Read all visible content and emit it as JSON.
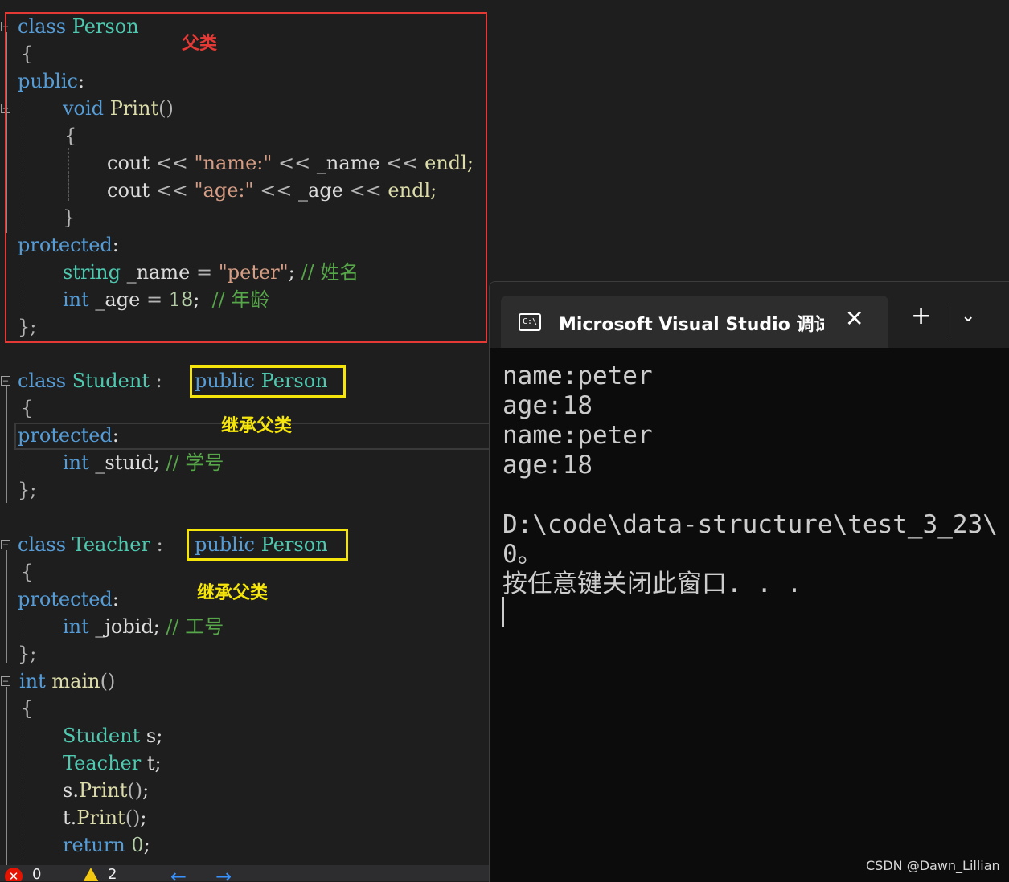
{
  "editor": {
    "annotations": {
      "parent_label": "父类",
      "inherit_label_1": "继承父类",
      "inherit_label_2": "继承父类"
    },
    "code": {
      "l1_kw": "class",
      "l1_ty": "Person",
      "brace_open": "{",
      "brace_close": "}",
      "brace_close_semi": "};",
      "public_kw": "public",
      "colon": ":",
      "void_kw": "void",
      "print_fn": "Print",
      "parens": "()",
      "cout": "cout",
      "shl": "<<",
      "str_name": "\"name:\"",
      "var_name": "_name",
      "endl": "endl;",
      "str_age": "\"age:\"",
      "var_age": "_age",
      "protected_kw": "protected",
      "string_ty": "string",
      "eq": "=",
      "str_peter": "\"peter\"",
      "semi": ";",
      "cm_name": "// 姓名",
      "int_kw": "int",
      "num_18": "18",
      "cm_age": "// 年龄",
      "student_ty": "Student",
      "public_person": "public Person",
      "teacher_ty": "Teacher",
      "var_stuid": "_stuid",
      "cm_stuid": "// 学号",
      "var_jobid": "_jobid",
      "cm_jobid": "// 工号",
      "main_fn": "main",
      "var_s": "s",
      "var_t": "t",
      "s_print": "s.",
      "t_print": "t.",
      "return_kw": "return",
      "num_0": "0"
    },
    "status": {
      "errors": "0",
      "warnings": "2",
      "back_arrow": "←",
      "fwd_arrow": "→"
    }
  },
  "console": {
    "tab_title": "Microsoft Visual Studio 调试控制台",
    "close_glyph": "✕",
    "plus_glyph": "+",
    "chevron_glyph": "⌄",
    "lines": [
      "name:peter",
      "age:18",
      "name:peter",
      "age:18",
      "",
      "D:\\code\\data-structure\\test_3_23\\",
      "0。",
      "按任意键关闭此窗口. . ."
    ]
  },
  "watermark": "CSDN @Dawn_Lillian"
}
